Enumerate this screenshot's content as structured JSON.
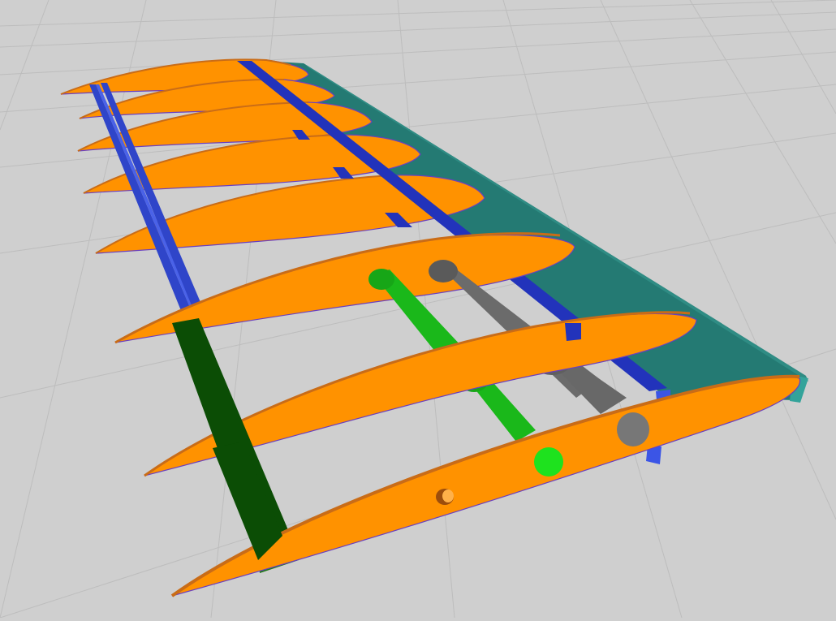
{
  "scene": {
    "background": "#cfcfcf",
    "grid_color": "#b8b8b8",
    "colors": {
      "rib": "#ff9200",
      "rib_top_edge": "#c96c17",
      "rib_outline": "#6a3fbf",
      "spar": "#2233bb",
      "spar_light": "#3b55e6",
      "trailing_edge": "#247a73",
      "trailing_edge_top": "#2f8c84",
      "sheeting": "#0b4d05",
      "rod_green": "#1cc41c",
      "rod_gray": "#6b6b6b"
    },
    "objects": {
      "ribs": 8,
      "spars": 3,
      "rods": 2
    }
  }
}
